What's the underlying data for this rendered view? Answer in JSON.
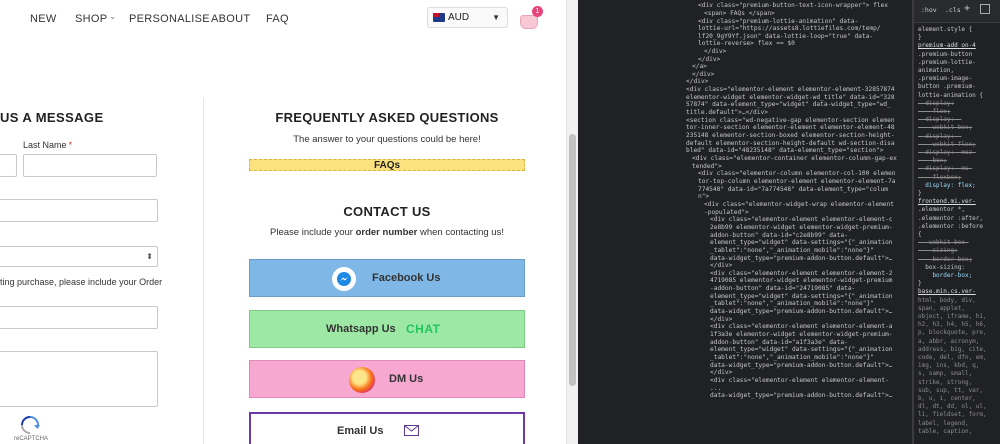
{
  "nav": {
    "items": [
      "NEW",
      "SHOP",
      "PERSONALISE",
      "ABOUT",
      "FAQ"
    ],
    "currency": "AUD",
    "cart_count": "1"
  },
  "form": {
    "title": "US A MESSAGE",
    "last_name_label": "Last Name",
    "required_mark": "*",
    "help_text": "ting purchase, please include your Order",
    "recaptcha_label": "reCAPTCHA"
  },
  "faq": {
    "title": "FREQUENTLY ASKED QUESTIONS",
    "subtitle": "The answer to your questions could be here!",
    "button": "FAQs"
  },
  "contact": {
    "title": "CONTACT US",
    "sub_before": "Please include your ",
    "sub_bold": "order number",
    "sub_after": " when contacting us!",
    "facebook": "Facebook Us",
    "whatsapp": "Whatsapp Us",
    "whatsapp_chat": "CHAT",
    "dm": "DM Us",
    "email": "Email Us"
  },
  "devtools": {
    "elements_lines": [
      "    <div class=\"premium-button-text-icon-wrapper\"> flex",
      "      <span> FAQs </span>",
      "    <div class=\"premium-lottie-animation\" data-",
      "    lottie-url=\"https://assets8.lottiefiles.com/temp/",
      "    lf20_9gY9Yf.json\" data-lottie-loop=\"true\" data-",
      "    lottie-reverse> flex == $0",
      "      </div>",
      "    </div>",
      "  </a>",
      "  </div>",
      "</div>",
      "<div class=\"elementor-element elementor-element-32857874",
      "elementor-widget elementor-widget-wd_title\" data-id=\"328",
      "57874\" data-element_type=\"widget\" data-widget_type=\"wd_",
      "title.default\">…</div>",
      "<section class=\"wd-negative-gap elementor-section elemen",
      "tor-inner-section elementor-element elementor-element-48",
      "235148 elementor-section-boxed elementor-section-height-",
      "default elementor-section-height-default wd-section-disa",
      "bled\" data-id=\"48235148\" data-element_type=\"section\">",
      "  <div class=\"elementor-container elementor-column-gap-ex",
      "  tended\">",
      "    <div class=\"elementor-column elementor-col-100 elemen",
      "    tor-top-column elementor-element elementor-element-7a",
      "    774548\" data-id=\"7a774548\" data-element_type=\"colum",
      "    n\">",
      "      <div class=\"elementor-widget-wrap elementor-element",
      "      -populated\">",
      "        <div class=\"elementor-element elementor-element-c",
      "        2e8b99 elementor-widget elementor-widget-premium-",
      "        addon-button\" data-id=\"c2e8b99\" data-",
      "        element_type=\"widget\" data-settings=\"{\"_animation",
      "        _tablet\":\"none\",\"_animation_mobile\":\"none\"}\"",
      "        data-widget_type=\"premium-addon-button.default\">…",
      "        </div>",
      "        <div class=\"elementor-element elementor-element-2",
      "        4719085 elementor-widget elementor-widget-premium",
      "        -addon-button\" data-id=\"24719085\" data-",
      "        element_type=\"widget\" data-settings=\"{\"_animation",
      "        _tablet\":\"none\",\"_animation_mobile\":\"none\"}\"",
      "        data-widget_type=\"premium-addon-button.default\">…",
      "        </div>",
      "        <div class=\"elementor-element elementor-element-a",
      "        1f3a3e elementor-widget elementor-widget-premium-",
      "        addon-button\" data-id=\"a1f3a3e\" data-",
      "        element_type=\"widget\" data-settings=\"{\"_animation",
      "        _tablet\":\"none\",\"_animation_mobile\":\"none\"}\"",
      "        data-widget_type=\"premium-addon-button.default\">…",
      "        </div>",
      "        <div class=\"elementor-element elementor-element-",
      "        ...",
      "        data-widget_type=\"premium-addon-button.default\">…"
    ],
    "styles": {
      "hov": ":hov",
      "cls": ".cls",
      "plus": "+",
      "lines": [
        "element.style {",
        "}",
        "premium-add on-4",
        ".premium-button",
        ".premium-lottie-",
        "animation,",
        ".premium-image-",
        "button .premium-",
        "lottie-animation {",
        "  display:",
        "    flex;",
        "  display: -",
        "    webkit-box;",
        "  display: -",
        "    webkit-flex;",
        "  display: -moz-",
        "    box;",
        "  display: -ms-",
        "    flexbox;",
        "  display: flex;",
        "}",
        "frontend.mi.ver-",
        ".elementor *,",
        ".elementor :after,",
        ".elementor :before",
        "{",
        "  -webkit-box-",
        "    sizing:",
        "    border-box;",
        "  box-sizing:",
        "    border-box;",
        "}",
        "base.min.cs.ver-",
        "html, body, div,",
        "span, applet,",
        "object, iframe, h1,",
        "h2, h3, h4, h5, h6,",
        "p, blockquote, pre,",
        "a, abbr, acronym,",
        "address, big, cite,",
        "code, del, dfn, em,",
        "img, ins, kbd, q,",
        "s, samp, small,",
        "strike, strong,",
        "sub, sup, tt, var,",
        "b, u, i, center,",
        "dl, dt, dd, ol, ul,",
        "li, fieldset, form,",
        "label, legend,",
        "table, caption,"
      ]
    }
  }
}
